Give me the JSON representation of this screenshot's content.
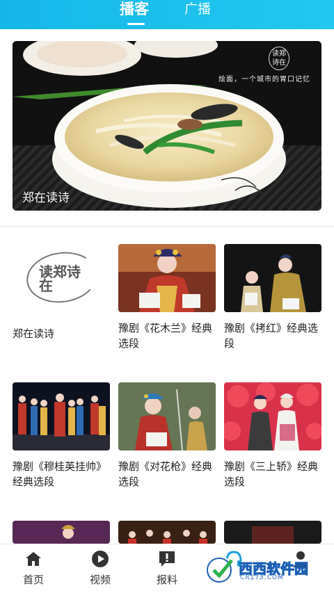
{
  "tabs": [
    {
      "label": "播客"
    },
    {
      "label": "广播"
    }
  ],
  "hero": {
    "title": "郑在读诗",
    "caption": "烩面，一个城市的胃口记忆",
    "logo_text": "读郑诗在"
  },
  "cards": [
    {
      "title": "郑在读诗",
      "logo_text": "读郑诗在"
    },
    {
      "title": "豫剧《花木兰》经典选段"
    },
    {
      "title": "豫剧《拷红》经典选段"
    },
    {
      "title": "豫剧《穆桂英挂帅》经典选段"
    },
    {
      "title": "豫剧《对花枪》经典选段"
    },
    {
      "title": "豫剧《三上轿》经典选段"
    }
  ],
  "bottom_nav": [
    {
      "label": "首页",
      "icon": "home-icon"
    },
    {
      "label": "视频",
      "icon": "play-icon"
    },
    {
      "label": "报料",
      "icon": "alert-icon"
    },
    {
      "label": "",
      "icon": "headphones-icon"
    },
    {
      "label": "",
      "icon": "profile-icon"
    }
  ],
  "watermark": {
    "text": "西西软件园",
    "sub": "CR173.COM"
  },
  "colors": {
    "topbar": "#1cbfeb",
    "text": "#222222"
  }
}
